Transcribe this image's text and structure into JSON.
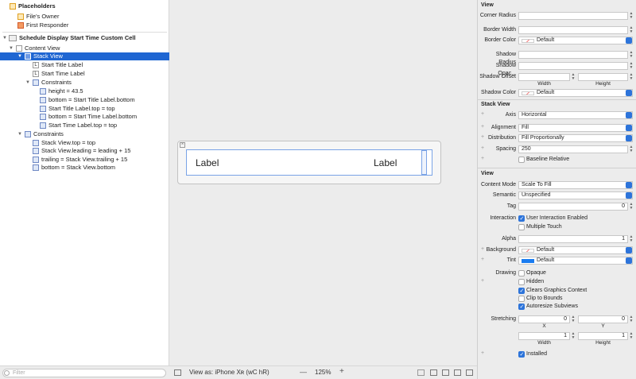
{
  "outline": {
    "placeholders_header": "Placeholders",
    "files_owner": "File's Owner",
    "first_responder": "First Responder",
    "cell": "Schedule Display Start Time Custom Cell",
    "content_view": "Content View",
    "stack_view": "Stack View",
    "start_title_label": "Start Title Label",
    "start_time_label": "Start Time Label",
    "constraints_inner": "Constraints",
    "c_height": "height = 43.5",
    "c_bottom_title": "bottom = Start Title Label.bottom",
    "c_top_title": "Start Title Label.top = top",
    "c_bottom_time": "bottom = Start Time Label.bottom",
    "c_top_time": "Start Time Label.top = top",
    "constraints_outer": "Constraints",
    "c_sv_top": "Stack View.top = top",
    "c_sv_leading": "Stack View.leading = leading + 15",
    "c_trailing": "trailing = Stack View.trailing + 15",
    "c_bottom_sv": "bottom = Stack View.bottom",
    "filter_placeholder": "Filter"
  },
  "canvas": {
    "label_left": "Label",
    "label_right": "Label",
    "view_as": "View as: iPhone Xʀ (wC hR)",
    "zoom": "125%",
    "zoom_out": "—",
    "zoom_in": "+"
  },
  "inspector": {
    "view_header": "View",
    "corner_radius": "Corner Radius",
    "border_width": "Border Width",
    "border_color": "Border Color",
    "border_color_val": "Default",
    "shadow_radius": "Shadow Radius",
    "shadow_opacity": "Shadow Opac...",
    "shadow_offset": "Shadow Offset",
    "width_lbl": "Width",
    "height_lbl": "Height",
    "shadow_color": "Shadow Color",
    "shadow_color_val": "Default",
    "stack_header": "Stack View",
    "axis": "Axis",
    "axis_val": "Horizontal",
    "alignment": "Alignment",
    "alignment_val": "Fill",
    "distribution": "Distribution",
    "distribution_val": "Fill Proportionally",
    "spacing": "Spacing",
    "spacing_val": "250",
    "baseline_relative": "Baseline Relative",
    "view2_header": "View",
    "content_mode": "Content Mode",
    "content_mode_val": "Scale To Fill",
    "semantic": "Semantic",
    "semantic_val": "Unspecified",
    "tag": "Tag",
    "tag_val": "0",
    "interaction": "Interaction",
    "user_interaction": "User Interaction Enabled",
    "multiple_touch": "Multiple Touch",
    "alpha": "Alpha",
    "alpha_val": "1",
    "background": "Background",
    "background_val": "Default",
    "tint": "Tint",
    "tint_val": "Default",
    "drawing": "Drawing",
    "opaque": "Opaque",
    "hidden": "Hidden",
    "clears": "Clears Graphics Context",
    "clip": "Clip to Bounds",
    "autoresize": "Autoresize Subviews",
    "stretching": "Stretching",
    "x_val": "0",
    "y_val": "0",
    "x_lbl": "X",
    "y_lbl": "Y",
    "w_val": "1",
    "h_val": "1",
    "installed": "Installed"
  },
  "colors": {
    "selection": "#1f66d2",
    "accent": "#2d74da",
    "tint_swatch": "#1a7cf0"
  }
}
